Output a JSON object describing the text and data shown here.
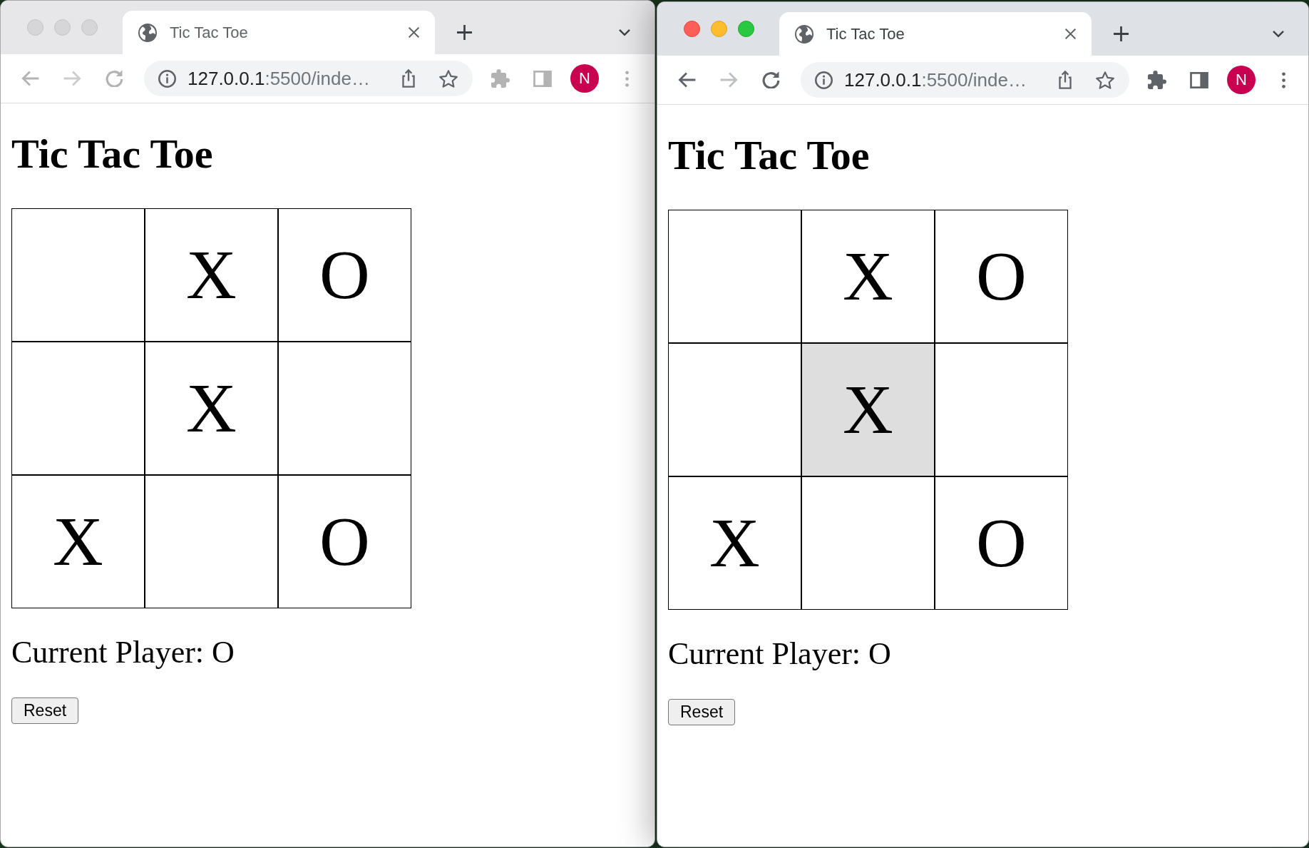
{
  "windows": [
    {
      "active": false,
      "tabs": [
        {
          "title": "Tic Tac Toe",
          "selected": true
        }
      ],
      "nav_buttons": [
        {
          "kind": "back",
          "disabled": false
        },
        {
          "kind": "forward",
          "disabled": true
        },
        {
          "kind": "reload",
          "disabled": false
        }
      ],
      "address_bar": {
        "host": "127.0.0.1",
        "rest": ":5500/inde…"
      },
      "profile_initial": "N",
      "page": {
        "heading": "Tic Tac Toe",
        "cells": [
          {
            "highlighted": false
          },
          {
            "mark": "X",
            "highlighted": false
          },
          {
            "mark": "O",
            "highlighted": false
          },
          {
            "highlighted": false
          },
          {
            "mark": "X",
            "highlighted": false
          },
          {
            "highlighted": false
          },
          {
            "mark": "X",
            "highlighted": false
          },
          {
            "highlighted": false
          },
          {
            "mark": "O",
            "highlighted": false
          }
        ],
        "status": "Current Player: O",
        "reset_button": "Reset"
      }
    },
    {
      "active": true,
      "tabs": [
        {
          "title": "Tic Tac Toe",
          "selected": true
        }
      ],
      "nav_buttons": [
        {
          "kind": "back",
          "disabled": false
        },
        {
          "kind": "forward",
          "disabled": true
        },
        {
          "kind": "reload",
          "disabled": false
        }
      ],
      "address_bar": {
        "host": "127.0.0.1",
        "rest": ":5500/inde…"
      },
      "profile_initial": "N",
      "page": {
        "heading": "Tic Tac Toe",
        "cells": [
          {
            "highlighted": false
          },
          {
            "mark": "X",
            "highlighted": false
          },
          {
            "mark": "O",
            "highlighted": false
          },
          {
            "highlighted": false
          },
          {
            "mark": "X",
            "highlighted": true
          },
          {
            "highlighted": false
          },
          {
            "mark": "X",
            "highlighted": false
          },
          {
            "highlighted": false
          },
          {
            "mark": "O",
            "highlighted": false
          }
        ],
        "status": "Current Player: O",
        "reset_button": "Reset"
      }
    }
  ]
}
